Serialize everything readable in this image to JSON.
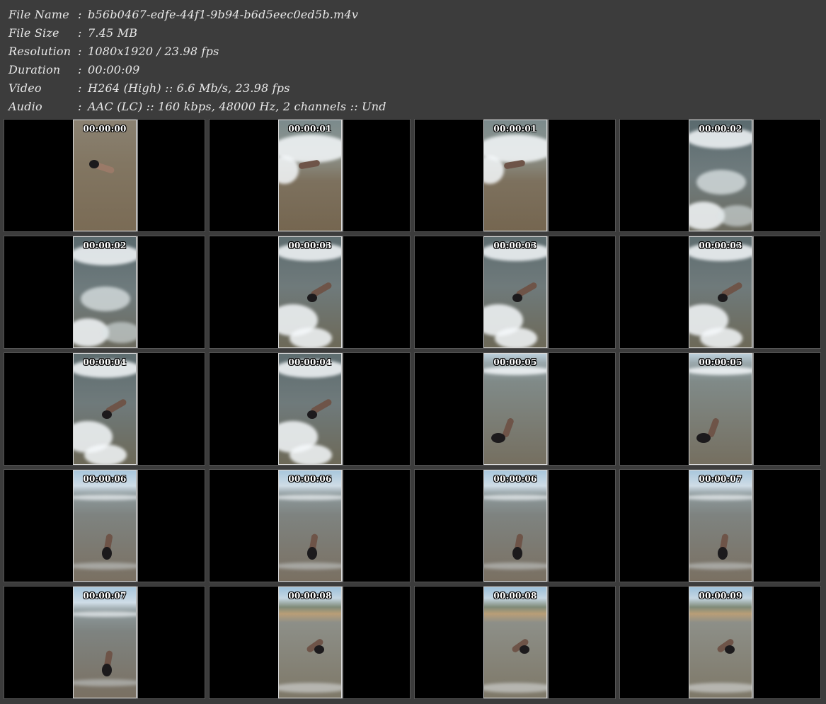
{
  "file_info": [
    {
      "label": "File Name",
      "value": "b56b0467-edfe-44f1-9b94-b6d5eec0ed5b.m4v"
    },
    {
      "label": "File Size",
      "value": "7.45 MB"
    },
    {
      "label": "Resolution",
      "value": "1080x1920 / 23.98 fps"
    },
    {
      "label": "Duration",
      "value": "00:00:09"
    },
    {
      "label": "Video",
      "value": "H264 (High) :: 6.6 Mb/s, 23.98 fps"
    },
    {
      "label": "Audio",
      "value": "AAC (LC) :: 160 kbps, 48000 Hz, 2 channels :: Und"
    }
  ],
  "separator": ":",
  "frames": [
    {
      "timestamp": "00:00:00",
      "scene": "sand"
    },
    {
      "timestamp": "00:00:01",
      "scene": "wave-edge"
    },
    {
      "timestamp": "00:00:01",
      "scene": "wave-edge"
    },
    {
      "timestamp": "00:00:02",
      "scene": "surf"
    },
    {
      "timestamp": "00:00:02",
      "scene": "surf"
    },
    {
      "timestamp": "00:00:03",
      "scene": "surf-person"
    },
    {
      "timestamp": "00:00:03",
      "scene": "surf-person"
    },
    {
      "timestamp": "00:00:03",
      "scene": "surf-person"
    },
    {
      "timestamp": "00:00:04",
      "scene": "surf-person"
    },
    {
      "timestamp": "00:00:04",
      "scene": "surf-person"
    },
    {
      "timestamp": "00:00:05",
      "scene": "shallow"
    },
    {
      "timestamp": "00:00:05",
      "scene": "shallow"
    },
    {
      "timestamp": "00:00:06",
      "scene": "sky-beach"
    },
    {
      "timestamp": "00:00:06",
      "scene": "sky-beach"
    },
    {
      "timestamp": "00:00:06",
      "scene": "sky-beach"
    },
    {
      "timestamp": "00:00:07",
      "scene": "sky-beach"
    },
    {
      "timestamp": "00:00:07",
      "scene": "sky-beach"
    },
    {
      "timestamp": "00:00:08",
      "scene": "sky-palms"
    },
    {
      "timestamp": "00:00:08",
      "scene": "sky-palms"
    },
    {
      "timestamp": "00:00:09",
      "scene": "sky-palms"
    }
  ]
}
